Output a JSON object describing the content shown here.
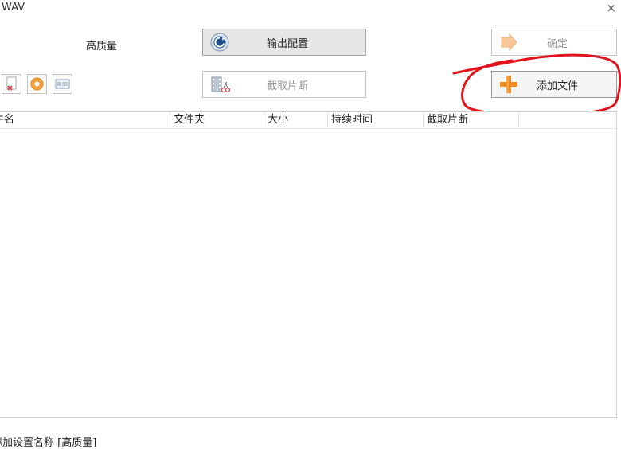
{
  "window": {
    "title": "WAV",
    "close_glyph": "×"
  },
  "preset": {
    "label": "高质量"
  },
  "buttons": {
    "output_config": "输出配置",
    "confirm": "确定",
    "clip": "截取片断",
    "add_file": "添加文件"
  },
  "table": {
    "columns": [
      "牛名",
      "文件夹",
      "大小",
      "持续时间",
      "截取片断"
    ]
  },
  "status": {
    "text": "添加设置名称 [高质量]"
  },
  "colors": {
    "accent_orange": "#f28a1b",
    "annotation_red": "#e0141b"
  }
}
